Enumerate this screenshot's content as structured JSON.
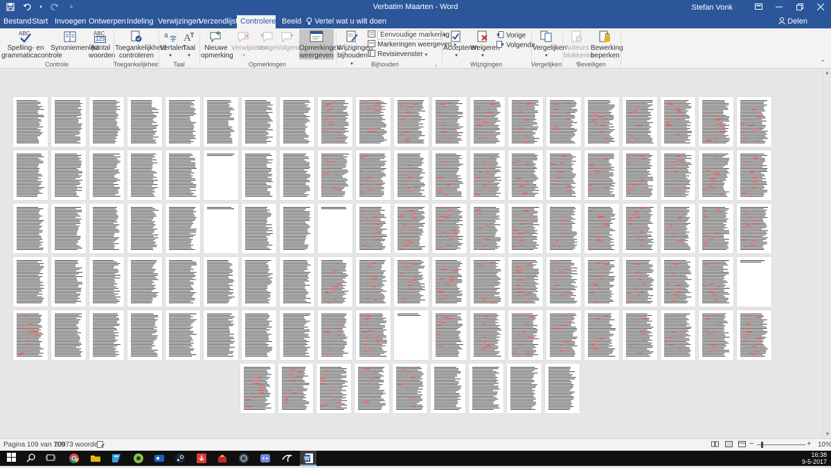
{
  "window": {
    "title": "Verbatim Maarten - Word",
    "user": "Stefan Vonk",
    "quick_access": [
      "save-icon",
      "undo-icon",
      "redo-icon",
      "customize-icon"
    ],
    "controls": [
      "ribbon-display-icon",
      "minimize-icon",
      "restore-icon",
      "close-icon"
    ]
  },
  "tabs": [
    "Bestand",
    "Start",
    "Invoegen",
    "Ontwerpen",
    "Indeling",
    "Verwijzingen",
    "Verzendlijsten",
    "Controleren",
    "Beeld"
  ],
  "active_tab": "Controleren",
  "tell_me": "Vertel wat u wilt doen",
  "share": "Delen",
  "ribbon": {
    "controle": {
      "group": "Controle",
      "spelling_1": "Spelling- en",
      "spelling_2": "grammaticacontrole",
      "abc": "ABC",
      "thesaurus": "Synoniemenlijst",
      "wordcount_1": "Aantal",
      "wordcount_2": "woorden",
      "wordcount_icon": "123"
    },
    "toegankelijkheid": {
      "group": "Toegankelijkheid",
      "check_1": "Toegankelijkheid",
      "check_2": "controleren"
    },
    "taal": {
      "group": "Taal",
      "translate": "Vertalen",
      "language": "Taal"
    },
    "opmerkingen": {
      "group": "Opmerkingen",
      "new_1": "Nieuwe",
      "new_2": "opmerking",
      "delete": "Verwijderen",
      "previous": "Vorige",
      "next": "Volgende",
      "show_1": "Opmerkingen",
      "show_2": "weergeven"
    },
    "bijhouden": {
      "group": "Bijhouden",
      "track_1": "Wijzigingen",
      "track_2": "bijhouden",
      "markup": "Eenvoudige markering",
      "show_markup": "Markeringen weergeven",
      "pane": "Revisievenster"
    },
    "wijzigingen": {
      "group": "Wijzigingen",
      "accept": "Accepteren",
      "reject": "Weigeren",
      "previous": "Vorige",
      "next": "Volgende"
    },
    "vergelijken": {
      "group": "Vergelijken",
      "compare": "Vergelijken"
    },
    "beveiligen": {
      "group": "Beveiligen",
      "block_1": "Auteurs",
      "block_2": "blokkeren",
      "restrict_1": "Bewerking",
      "restrict_2": "beperken"
    }
  },
  "document": {
    "page_count": 109,
    "pages_per_row": 20,
    "blank_pages": [
      26,
      46,
      49,
      80,
      91
    ],
    "red_heavy_pages": [
      9,
      10,
      11,
      12,
      13,
      14,
      15,
      16,
      17,
      18,
      19,
      20,
      29,
      30,
      31,
      32,
      33,
      34,
      35,
      36,
      37,
      38,
      39,
      40,
      49,
      50,
      51,
      52,
      53,
      54,
      55,
      56,
      57,
      58,
      59,
      60,
      69,
      70,
      71,
      72,
      73,
      74,
      75,
      76,
      77,
      78,
      79,
      81,
      89,
      90,
      92,
      93,
      94,
      95,
      96,
      97,
      98,
      99,
      100,
      101,
      102,
      103,
      104,
      105
    ]
  },
  "status": {
    "page": "Pagina 109 van 109",
    "words": "70973 woorden",
    "zoom": "10%"
  },
  "taskbar": {
    "apps": [
      "windows-start-icon",
      "search-icon",
      "task-view-icon",
      "chrome-icon",
      "file-explorer-icon",
      "app-icon",
      "app-icon",
      "steam-icon",
      "app-icon",
      "app-icon",
      "app-icon",
      "discord-icon",
      "app-icon",
      "word-icon"
    ],
    "time": "16:38",
    "date": "9-5-2017"
  },
  "colors": {
    "word_blue": "#2b579a",
    "ribbon_bg": "#f3f3f3",
    "doc_bg": "#e6e6e6",
    "revision_red": "#d21f1f"
  }
}
